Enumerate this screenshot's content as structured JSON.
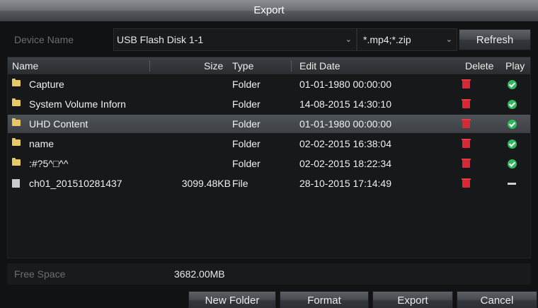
{
  "window": {
    "title": "Export"
  },
  "device": {
    "label": "Device Name",
    "selected": "USB Flash Disk 1-1",
    "filter": "*.mp4;*.zip",
    "refresh_label": "Refresh"
  },
  "table": {
    "headers": {
      "name": "Name",
      "size": "Size",
      "type": "Type",
      "date": "Edit Date",
      "delete": "Delete",
      "play": "Play"
    },
    "rows": [
      {
        "name": "Capture",
        "size": "",
        "type": "Folder",
        "date": "01-01-1980 00:00:00",
        "icon": "folder-icon",
        "play": "play-icon"
      },
      {
        "name": "System Volume Inforn",
        "size": "",
        "type": "Folder",
        "date": "14-08-2015 14:30:10",
        "icon": "folder-icon",
        "play": "play-icon"
      },
      {
        "name": "UHD Content",
        "size": "",
        "type": "Folder",
        "date": "01-01-1980 00:00:00",
        "icon": "folder-icon",
        "play": "play-icon",
        "selected": true
      },
      {
        "name": "name",
        "size": "",
        "type": "Folder",
        "date": "02-02-2015 16:38:04",
        "icon": "folder-icon",
        "play": "play-icon"
      },
      {
        "name": ":#?5^□^^",
        "size": "",
        "type": "Folder",
        "date": "02-02-2015 18:22:34",
        "icon": "folder-icon",
        "play": "play-icon"
      },
      {
        "name": "ch01_201510281437",
        "size": "3099.48KB",
        "type": "File",
        "date": "28-10-2015 17:14:49",
        "icon": "file-icon",
        "play": "dash"
      }
    ]
  },
  "free_space": {
    "label": "Free Space",
    "value": "3682.00MB"
  },
  "buttons": {
    "new_folder": "New Folder",
    "format": "Format",
    "export": "Export",
    "cancel": "Cancel"
  },
  "colors": {
    "selection": "#4e5358",
    "delete": "#d52a36",
    "play": "#2eb85c",
    "folder": "#e7c766"
  }
}
